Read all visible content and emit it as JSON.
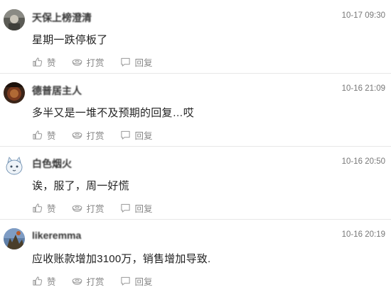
{
  "actions": {
    "like": "赞",
    "reward": "打赏",
    "reply": "回复"
  },
  "comments": [
    {
      "username": "天保上榜澄清",
      "time": "10-17 09:30",
      "text": "星期一跌停板了",
      "avatar_icon": "photo-avatar"
    },
    {
      "username": "德普居主人",
      "time": "10-16 21:09",
      "text": "多半又是一堆不及预期的回复…哎",
      "avatar_icon": "photo-avatar"
    },
    {
      "username": "白色烟火",
      "time": "10-16 20:50",
      "text": "诶，服了，周一好慌",
      "avatar_icon": "cartoon-cat-avatar"
    },
    {
      "username": "likeremma",
      "time": "10-16 20:19",
      "text": "应收账款增加3100万，销售增加导致.",
      "avatar_icon": "photo-avatar"
    }
  ]
}
